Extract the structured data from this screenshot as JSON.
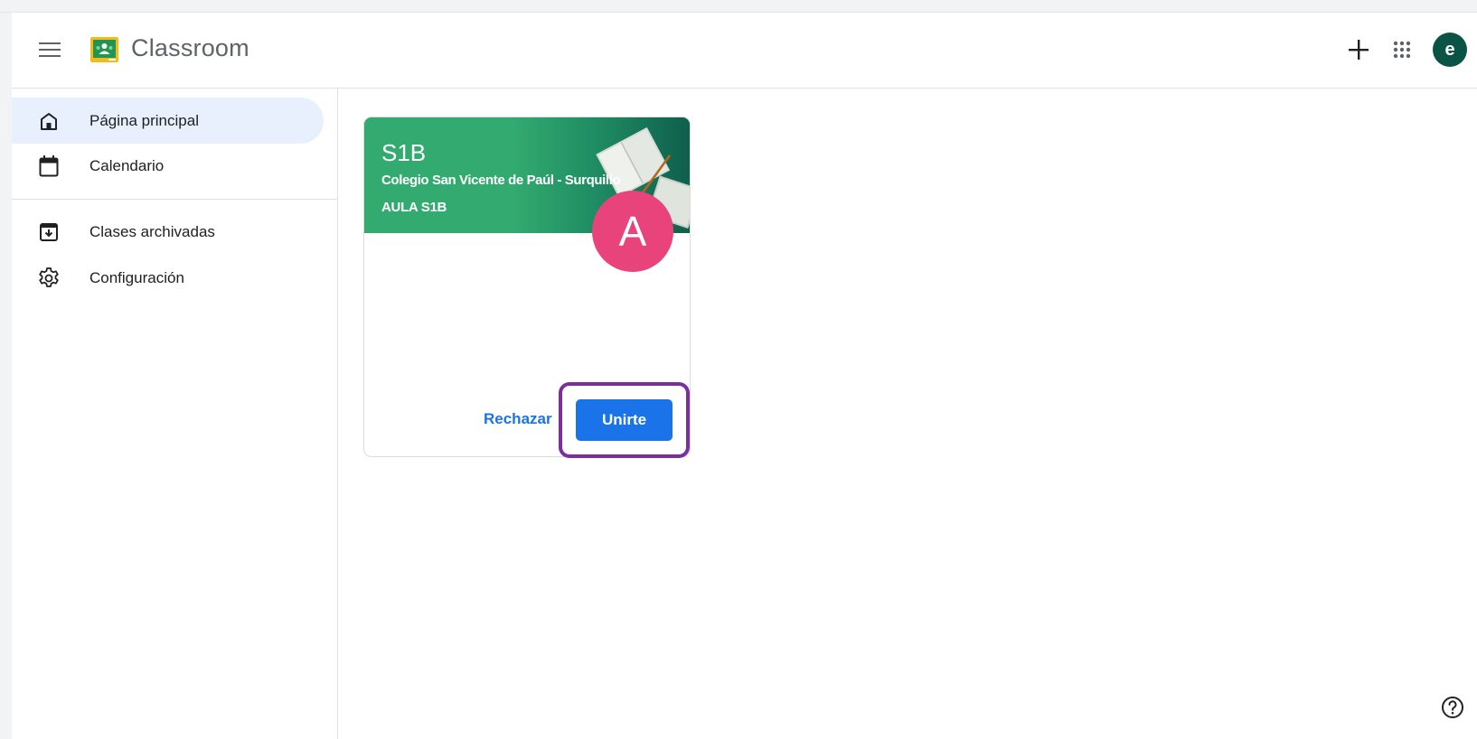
{
  "header": {
    "app_title": "Classroom",
    "menu_icon": "hamburger-menu-icon",
    "logo_icon": "classroom-logo-icon",
    "create_icon": "plus-icon",
    "apps_icon": "apps-grid-icon",
    "avatar_letter": "e",
    "avatar_color": "#0b5345"
  },
  "sidebar": {
    "items": [
      {
        "label": "Página principal",
        "icon": "home-icon",
        "active": true
      },
      {
        "label": "Calendario",
        "icon": "calendar-icon",
        "active": false
      },
      {
        "label": "Clases archivadas",
        "icon": "archive-icon",
        "active": false
      },
      {
        "label": "Configuración",
        "icon": "gear-icon",
        "active": false
      }
    ],
    "active_color": "#e8f0fe"
  },
  "class_card": {
    "title": "S1B",
    "subtitle": "Colegio San Vicente de Paúl - Surquillo",
    "section": "AULA S1B",
    "teacher_initial": "A",
    "banner_color": "#33ab70",
    "avatar_color": "#e8437a",
    "reject_label": "Rechazar",
    "join_label": "Unirte",
    "join_color": "#1a73e8",
    "highlight_color": "#7b2f9e"
  },
  "help_icon": "help-circle-icon"
}
